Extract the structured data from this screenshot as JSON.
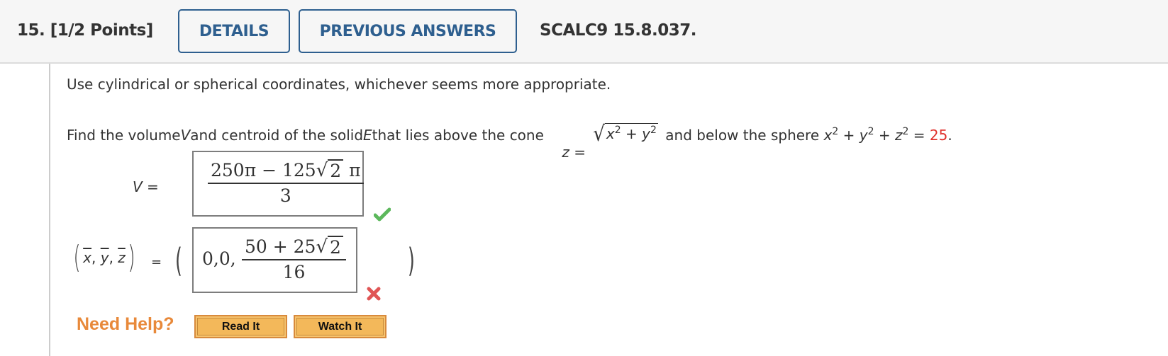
{
  "header": {
    "question_label": "15.  [1/2 Points]",
    "details_button": "DETAILS",
    "previous_answers_button": "PREVIOUS ANSWERS",
    "question_ref": "SCALC9 15.8.037."
  },
  "problem": {
    "instruction": "Use cylindrical or spherical coordinates, whichever seems more appropriate.",
    "statement_part1": "Find the volume ",
    "statement_var_v": "V",
    "statement_part2": " and centroid of the solid ",
    "statement_var_e": "E",
    "statement_part3": " that lies above the cone ",
    "cone_lhs": "z",
    "equals": " = ",
    "cone_radicand_x": "x",
    "cone_radicand_plus": " + ",
    "cone_radicand_y": "y",
    "exp2": "2",
    "statement_part4": " and below the sphere ",
    "sphere_x": "x",
    "sphere_y": "y",
    "sphere_z": "z",
    "plus": " + ",
    "sphere_value": "25",
    "period": ".",
    "accent_red": "#e0302b"
  },
  "answers": {
    "volume": {
      "label_var": "V",
      "label_eq": " =",
      "numerator_a": "250π − 125",
      "radicand": "2",
      "numerator_b": " π",
      "denominator": "3",
      "status": "correct"
    },
    "centroid": {
      "label_x": "x",
      "label_y": "y",
      "label_z": "z",
      "sep": ", ",
      "eq": "=",
      "open_paren": "(",
      "close_paren": ")",
      "prefix": "0,0,",
      "numerator_a": "50 + 25",
      "radicand": "2",
      "denominator": "16",
      "status": "incorrect"
    }
  },
  "help": {
    "label": "Need Help?",
    "read_it": "Read It",
    "watch_it": "Watch It"
  },
  "colors": {
    "brand_blue": "#2e5f8f",
    "help_orange": "#e8893a",
    "correct_green": "#5cb85c",
    "incorrect_red": "#e05555"
  }
}
